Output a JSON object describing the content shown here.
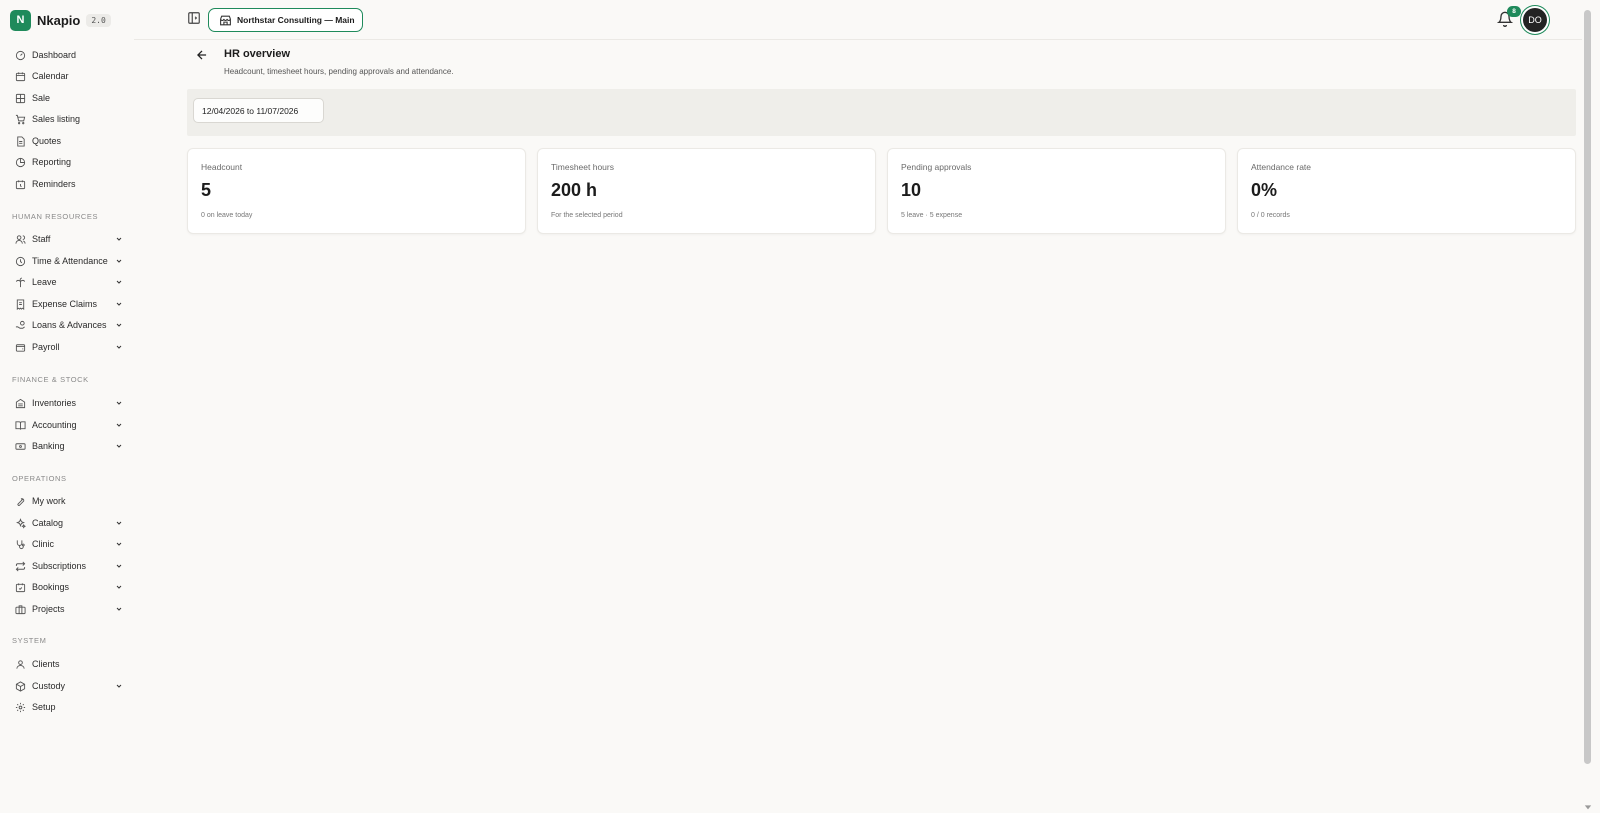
{
  "brand": {
    "initial": "N",
    "name": "Nkapio",
    "version": "2.0"
  },
  "sidebar": {
    "top_items": [
      {
        "label": "Dashboard",
        "icon": "gauge-icon"
      },
      {
        "label": "Calendar",
        "icon": "calendar-icon"
      },
      {
        "label": "Sale",
        "icon": "grid-icon"
      },
      {
        "label": "Sales listing",
        "icon": "cart-icon"
      },
      {
        "label": "Quotes",
        "icon": "document-icon"
      },
      {
        "label": "Reporting",
        "icon": "pie-chart-icon"
      },
      {
        "label": "Reminders",
        "icon": "calendar-clock-icon"
      }
    ],
    "sections": [
      {
        "title": "HUMAN RESOURCES",
        "items": [
          {
            "label": "Staff",
            "icon": "users-icon"
          },
          {
            "label": "Time & Attendance",
            "icon": "clock-icon"
          },
          {
            "label": "Leave",
            "icon": "palm-tree-icon"
          },
          {
            "label": "Expense Claims",
            "icon": "receipt-icon"
          },
          {
            "label": "Loans & Advances",
            "icon": "hand-coins-icon"
          },
          {
            "label": "Payroll",
            "icon": "wallet-icon"
          }
        ]
      },
      {
        "title": "FINANCE & STOCK",
        "items": [
          {
            "label": "Inventories",
            "icon": "warehouse-icon"
          },
          {
            "label": "Accounting",
            "icon": "book-icon"
          },
          {
            "label": "Banking",
            "icon": "banknote-icon"
          }
        ]
      },
      {
        "title": "OPERATIONS",
        "items": [
          {
            "label": "My work",
            "icon": "wrench-icon"
          },
          {
            "label": "Catalog",
            "icon": "sparkles-icon"
          },
          {
            "label": "Clinic",
            "icon": "stethoscope-icon"
          },
          {
            "label": "Subscriptions",
            "icon": "repeat-icon"
          },
          {
            "label": "Bookings",
            "icon": "calendar-check-icon"
          },
          {
            "label": "Projects",
            "icon": "briefcase-icon"
          }
        ]
      },
      {
        "title": "SYSTEM",
        "items": [
          {
            "label": "Clients",
            "icon": "user-icon"
          },
          {
            "label": "Custody",
            "icon": "package-icon"
          },
          {
            "label": "Setup",
            "icon": "gear-icon"
          }
        ]
      }
    ]
  },
  "topbar": {
    "company": "Northstar Consulting — Main",
    "notification_count": "8",
    "avatar_initials": "DO"
  },
  "page": {
    "title": "HR overview",
    "subtitle": "Headcount, timesheet hours, pending approvals and attendance.",
    "date_range": "12/04/2026 to 11/07/2026"
  },
  "cards": [
    {
      "label": "Headcount",
      "value": "5",
      "sub": "0 on leave today"
    },
    {
      "label": "Timesheet hours",
      "value": "200 h",
      "sub": "For the selected period"
    },
    {
      "label": "Pending approvals",
      "value": "10",
      "sub": "5 leave · 5 expense"
    },
    {
      "label": "Attendance rate",
      "value": "0%",
      "sub": "0 / 0 records"
    }
  ],
  "colors": {
    "accent": "#1f8a5b",
    "background": "#faf9f7"
  }
}
